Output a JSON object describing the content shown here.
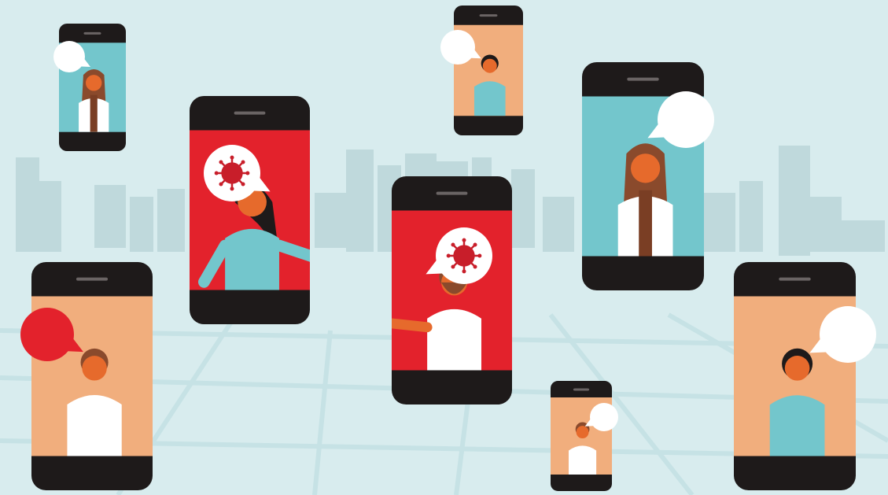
{
  "scene": {
    "background_color": "#d8ecee",
    "skyline_color": "#bfd9dc",
    "street_color": "#c9e4e7",
    "phone_body_color": "#1e1a1a",
    "screen_colors": {
      "red": "#e3222c",
      "peach": "#f1ae7d",
      "teal": "#73c6cc"
    },
    "bubble_colors": {
      "white": "#ffffff",
      "red": "#e3222c",
      "virus": "#c81e2a"
    },
    "people_colors": {
      "skin": "#e66a2c",
      "hair_dark": "#1e1a1a",
      "hair_brown": "#8a4a2c",
      "shirt_teal": "#73c6cc",
      "shirt_white": "#ffffff",
      "coat_inner": "#7a3e24"
    },
    "phones": [
      {
        "name": "phone-top-left-small",
        "screen": "teal",
        "person": "doctor-woman",
        "bubble": "white"
      },
      {
        "name": "phone-red-woman",
        "screen": "red",
        "person": "woman-teal-shirt",
        "bubble": "virus"
      },
      {
        "name": "phone-top-center-small",
        "screen": "peach",
        "person": "man-teal-shirt",
        "bubble": "white"
      },
      {
        "name": "phone-doctor-right",
        "screen": "teal",
        "person": "doctor-woman",
        "bubble": "white"
      },
      {
        "name": "phone-red-man-center",
        "screen": "red",
        "person": "bearded-man",
        "bubble": "virus"
      },
      {
        "name": "phone-bottom-left",
        "screen": "peach",
        "person": "man-white-shirt",
        "bubble": "red"
      },
      {
        "name": "phone-bottom-center-small",
        "screen": "peach",
        "person": "man-white-shirt",
        "bubble": "white"
      },
      {
        "name": "phone-bottom-right",
        "screen": "peach",
        "person": "man-teal-shirt",
        "bubble": "white"
      }
    ]
  }
}
